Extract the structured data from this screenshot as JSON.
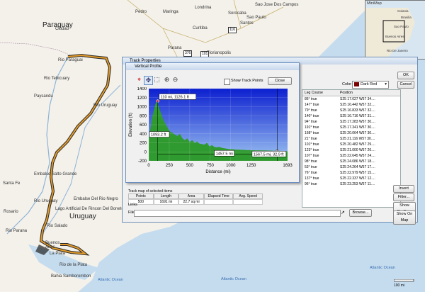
{
  "map": {
    "labels": [
      {
        "id": "paraguay",
        "text": "Paraguay",
        "x": 60,
        "y": 30,
        "big": true
      },
      {
        "id": "uruguay",
        "text": "Uruguay",
        "x": 98,
        "y": 300,
        "big": true
      },
      {
        "id": "rosario",
        "text": "Rosario",
        "x": 5,
        "y": 296
      },
      {
        "id": "rio-parana",
        "text": "Rio Parana",
        "x": 8,
        "y": 323
      },
      {
        "id": "buenos",
        "text": "Buenos",
        "x": 64,
        "y": 340
      },
      {
        "id": "aires",
        "text": "Aires",
        "x": 64,
        "y": 346
      },
      {
        "id": "la-plata",
        "text": "La Plata",
        "x": 70,
        "y": 355
      },
      {
        "id": "rio-de-la-plata",
        "text": "Rio de la Plata",
        "x": 84,
        "y": 371
      },
      {
        "id": "bahia",
        "text": "Bahia Samborombon",
        "x": 72,
        "y": 387
      },
      {
        "id": "atlantic1",
        "text": "Atlantic Ocean",
        "x": 138,
        "y": 392,
        "ocean": true
      },
      {
        "id": "atlantic2",
        "text": "Atlantic Ocean",
        "x": 312,
        "y": 391,
        "ocean": true
      },
      {
        "id": "atlantic3",
        "text": "Atlantic Ocean",
        "x": 522,
        "y": 375,
        "ocean": true
      },
      {
        "id": "rio-paraguai",
        "text": "Rio Paraguai",
        "x": 82,
        "y": 82
      },
      {
        "id": "rio-tebicuary",
        "text": "Rio Tebicuary",
        "x": 62,
        "y": 108
      },
      {
        "id": "paysandu",
        "text": "Paysandu",
        "x": 48,
        "y": 133
      },
      {
        "id": "rio-uruguay",
        "text": "Rio Uruguay",
        "x": 132,
        "y": 146
      },
      {
        "id": "embalse",
        "text": "Embalse Salto Grande",
        "x": 48,
        "y": 243
      },
      {
        "id": "rio-negro",
        "text": "Embalse Del Rio Negro",
        "x": 104,
        "y": 278
      },
      {
        "id": "lago",
        "text": "Lago Artificial De Rincon Del Bonete",
        "x": 78,
        "y": 292
      },
      {
        "id": "santa-fe",
        "text": "Santa Fe",
        "x": 4,
        "y": 256
      },
      {
        "id": "rio-sal",
        "text": "Rio Salado",
        "x": 66,
        "y": 316
      },
      {
        "id": "rio-uruguay2",
        "text": "Rio Uruguay",
        "x": 48,
        "y": 281
      },
      {
        "id": "pedro",
        "text": "Pedro",
        "x": 191,
        "y": 14
      },
      {
        "id": "maringa",
        "text": "Maringa",
        "x": 230,
        "y": 14
      },
      {
        "id": "londrina",
        "text": "Londrina",
        "x": 275,
        "y": 8
      },
      {
        "id": "sorocaba",
        "text": "Sorocaba",
        "x": 322,
        "y": 16
      },
      {
        "id": "saojose",
        "text": "Sao Jose Dos Campos",
        "x": 360,
        "y": 4
      },
      {
        "id": "saopaulo",
        "text": "Sao Paulo",
        "x": 348,
        "y": 22
      },
      {
        "id": "santos",
        "text": "Santos",
        "x": 339,
        "y": 30
      },
      {
        "id": "curitiba",
        "text": "Curitiba",
        "x": 272,
        "y": 37
      },
      {
        "id": "parana",
        "text": "Parana",
        "x": 237,
        "y": 65
      },
      {
        "id": "florianopolis",
        "text": "Florianopolis",
        "x": 292,
        "y": 72
      },
      {
        "id": "ciudad",
        "text": "Ciudad",
        "x": 78,
        "y": 38
      }
    ],
    "shields": [
      {
        "id": "s116",
        "text": "116",
        "x": 322,
        "y": 38
      },
      {
        "id": "s376",
        "text": "376",
        "x": 259,
        "y": 71
      },
      {
        "id": "s101",
        "text": "101",
        "x": 283,
        "y": 72
      }
    ],
    "minimap": {
      "title": "MiniMap",
      "labels": [
        "Goiania",
        "Brasilia",
        "Sao Paulo",
        "Buenos Aires",
        "Rio De Janeiro"
      ]
    },
    "scale": "100 mi",
    "track_color": "#e39a2a"
  },
  "track_props": {
    "title": "Track Properties",
    "ok": "OK",
    "cancel": "Cancel",
    "color_label": "Color",
    "color_value": "Dark Red",
    "columns": [
      "Leg Course",
      "Position"
    ],
    "rows": [
      [
        "86° true",
        "S25 17.027 W57 34...."
      ],
      [
        "147° true",
        "S25 16.442 W57 32...."
      ],
      [
        "79° true",
        "S25 16.833 W57 32...."
      ],
      [
        "140° true",
        "S25 16.716 W57 31...."
      ],
      [
        "94° true",
        "S25 17.283 W57 30...."
      ],
      [
        "191° true",
        "S25 17.341 W57 30...."
      ],
      [
        "168° true",
        "S25 20.064 W57 30...."
      ],
      [
        "21° true",
        "S25 21.116 W57 30...."
      ],
      [
        "101° true",
        "S25 20.482 W57 29...."
      ],
      [
        "123° true",
        "S25 21.000 W57 26...."
      ],
      [
        "107° true",
        "S25 22.645 W57 24...."
      ],
      [
        "98° true",
        "S25 24.086 W57 18...."
      ],
      [
        "53° true",
        "S25 24.264 W57 17...."
      ],
      [
        "76° true",
        "S25 22.979 W57 15...."
      ],
      [
        "137° true",
        "S25 22.337 W57 12...."
      ],
      [
        "96° true",
        "S25 23.253 W57 11...."
      ]
    ],
    "stats_header": [
      "Points",
      "Length",
      "Area",
      "Elapsed Time",
      "Avg. Speed"
    ],
    "stats_values": [
      "500",
      "1691 mi",
      "22.7 sq mi",
      "",
      ""
    ],
    "tab_text": "Track map of selected items",
    "links_label": "Links",
    "file_label": "File/URL:",
    "browse": "Browse...",
    "invert": "Invert",
    "filter": "Filter...",
    "show_profile": "Show Profile...",
    "show_on_map": "Show On Map"
  },
  "vertical_profile": {
    "title": "Vertical Profile",
    "show_points": "Show Track Points",
    "close": "Close",
    "tools": [
      "target",
      "pan",
      "zoom-rect",
      "zoom-in",
      "zoom-out"
    ]
  },
  "chart_data": {
    "type": "area",
    "xlabel": "Distance (mi)",
    "ylabel": "Elevation (ft)",
    "xlim": [
      0,
      1693
    ],
    "ylim": [
      -200,
      1400
    ],
    "xticks": [
      0,
      250,
      500,
      750,
      1000,
      1250,
      1693
    ],
    "yticks": [
      -200,
      0,
      200,
      400,
      600,
      800,
      1000,
      1200,
      1400
    ],
    "fill": "#2f9a2f",
    "background_top": "#0c1fd0",
    "background_bottom": "#9dc4f2",
    "x": [
      0,
      20,
      40,
      60,
      80,
      100,
      120,
      150,
      180,
      210,
      240,
      260,
      290,
      320,
      350,
      380,
      410,
      440,
      470,
      500,
      530,
      560,
      590,
      620,
      650,
      680,
      710,
      740,
      770,
      800,
      830,
      860,
      890,
      920,
      950,
      980,
      1010,
      1040,
      1070,
      1100,
      1130,
      1160,
      1190,
      1220,
      1250,
      1280,
      1310,
      1340,
      1370,
      1400,
      1430,
      1460,
      1490,
      1520,
      1550,
      1580,
      1610,
      1640,
      1670,
      1693
    ],
    "y": [
      300,
      500,
      750,
      900,
      1050,
      1126,
      1000,
      850,
      700,
      600,
      500,
      450,
      420,
      380,
      350,
      400,
      300,
      260,
      300,
      220,
      260,
      200,
      230,
      180,
      170,
      160,
      200,
      120,
      150,
      110,
      100,
      110,
      90,
      80,
      70,
      60,
      60,
      55,
      50,
      50,
      45,
      45,
      40,
      40,
      35,
      35,
      32,
      33,
      30,
      30,
      30,
      28,
      28,
      25,
      25,
      22,
      20,
      18,
      15,
      10
    ],
    "annotations": [
      {
        "text": "110 mi, 1126.1 ft",
        "x": 110,
        "y": 1126.1
      },
      {
        "text": "1093.2 ft",
        "x": 110,
        "y": 300
      },
      {
        "text": "1457.5 mi",
        "x": 1000,
        "y": 0
      },
      {
        "text": "1567.5 mi, 32.9 ft",
        "x": 1567.5,
        "y": 32.9
      }
    ]
  }
}
